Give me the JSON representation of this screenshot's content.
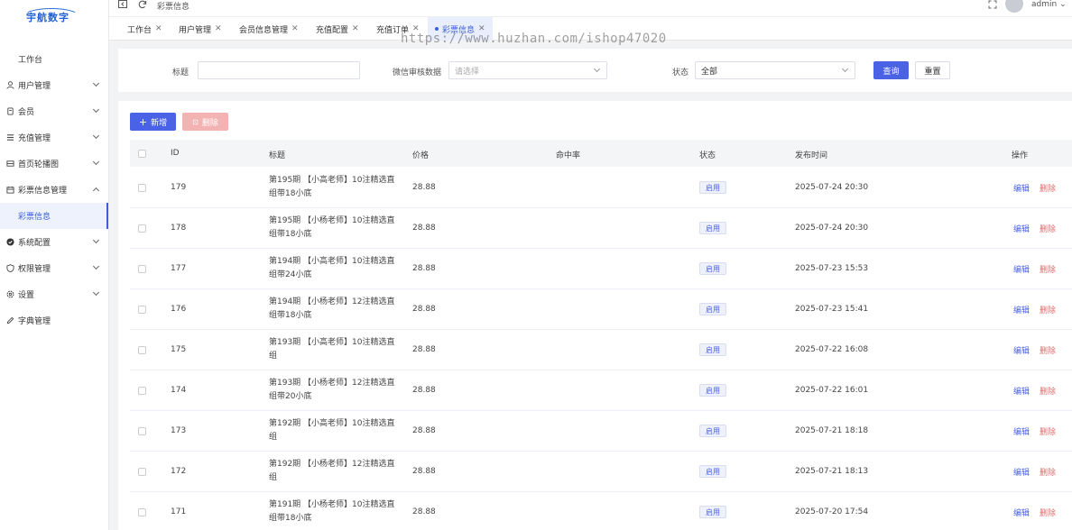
{
  "logo": {
    "text": "宇航数字"
  },
  "sidebar": {
    "items": [
      {
        "label": "工作台",
        "icon": "none",
        "type": "plain"
      },
      {
        "label": "用户管理",
        "icon": "user-icon",
        "type": "group",
        "expanded": false
      },
      {
        "label": "会员",
        "icon": "member-icon",
        "type": "group",
        "expanded": false
      },
      {
        "label": "充值管理",
        "icon": "list-icon",
        "type": "group",
        "expanded": false
      },
      {
        "label": "首页轮播图",
        "icon": "carousel-icon",
        "type": "group",
        "expanded": false
      },
      {
        "label": "彩票信息管理",
        "icon": "calendar-icon",
        "type": "group",
        "expanded": true
      },
      {
        "label": "彩票信息",
        "icon": "none",
        "type": "sub",
        "active": true
      },
      {
        "label": "系统配置",
        "icon": "check-circle-icon",
        "type": "group",
        "expanded": false
      },
      {
        "label": "权限管理",
        "icon": "shield-icon",
        "type": "group",
        "expanded": false
      },
      {
        "label": "设置",
        "icon": "gear-icon",
        "type": "group",
        "expanded": false
      },
      {
        "label": "字典管理",
        "icon": "edit-icon",
        "type": "plain-icon"
      }
    ]
  },
  "topbar": {
    "breadcrumb": "彩票信息",
    "user": "admin"
  },
  "tabs": [
    {
      "label": "工作台",
      "active": false
    },
    {
      "label": "用户管理",
      "active": false
    },
    {
      "label": "会员信息管理",
      "active": false
    },
    {
      "label": "充值配置",
      "active": false
    },
    {
      "label": "充值订单",
      "active": false
    },
    {
      "label": "彩票信息",
      "active": true
    }
  ],
  "watermark": "https://www.huzhan.com/ishop47020",
  "search": {
    "title_label": "标题",
    "title_value": "",
    "wechat_label": "微信审核数据",
    "wechat_placeholder": "请选择",
    "status_label": "状态",
    "status_value": "全部",
    "query_button": "查询",
    "reset_button": "重置"
  },
  "toolbar": {
    "add_button": "新增",
    "delete_button": "删除"
  },
  "table": {
    "columns": [
      "ID",
      "标题",
      "价格",
      "命中率",
      "状态",
      "发布时间",
      "操作"
    ],
    "edit_label": "编辑",
    "delete_label": "删除",
    "rows": [
      {
        "id": "179",
        "title": "第195期 【小高老师】10注精选直组带18小底",
        "price": "28.88",
        "hit_rate": "",
        "status": "启用",
        "time": "2025-07-24 20:30"
      },
      {
        "id": "178",
        "title": "第195期 【小杨老师】10注精选直组带18小底",
        "price": "28.88",
        "hit_rate": "",
        "status": "启用",
        "time": "2025-07-24 20:30"
      },
      {
        "id": "177",
        "title": "第194期 【小高老师】10注精选直组带24小底",
        "price": "28.88",
        "hit_rate": "",
        "status": "启用",
        "time": "2025-07-23 15:53"
      },
      {
        "id": "176",
        "title": "第194期 【小杨老师】12注精选直组带18小底",
        "price": "28.88",
        "hit_rate": "",
        "status": "启用",
        "time": "2025-07-23 15:41"
      },
      {
        "id": "175",
        "title": "第193期 【小高老师】10注精选直组",
        "price": "28.88",
        "hit_rate": "",
        "status": "启用",
        "time": "2025-07-22 16:08"
      },
      {
        "id": "174",
        "title": "第193期 【小杨老师】12注精选直组带20小底",
        "price": "28.88",
        "hit_rate": "",
        "status": "启用",
        "time": "2025-07-22 16:01"
      },
      {
        "id": "173",
        "title": "第192期 【小高老师】10注精选直组",
        "price": "28.88",
        "hit_rate": "",
        "status": "启用",
        "time": "2025-07-21 18:18"
      },
      {
        "id": "172",
        "title": "第192期 【小杨老师】12注精选直组",
        "price": "28.88",
        "hit_rate": "",
        "status": "启用",
        "time": "2025-07-21 18:13"
      },
      {
        "id": "171",
        "title": "第191期 【小杨老师】10注精选直组带18小底",
        "price": "28.88",
        "hit_rate": "",
        "status": "启用",
        "time": "2025-07-20 17:54"
      }
    ]
  },
  "colors": {
    "primary": "#4a62e6",
    "danger": "#e06a6a",
    "active_bg": "#eef2fd"
  }
}
